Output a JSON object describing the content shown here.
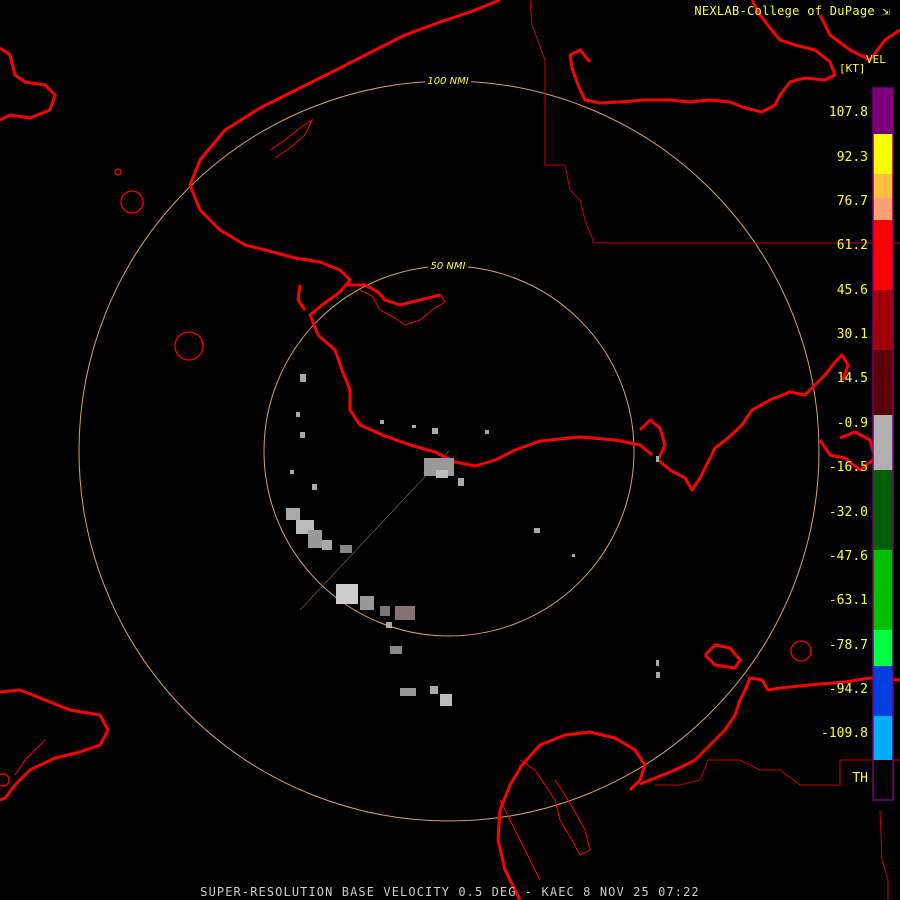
{
  "header": {
    "credit": "NEXLAB-College of DuPage",
    "credit_icon": "external-link-icon"
  },
  "colorbar": {
    "title": "VEL",
    "unit": "[KT]",
    "labels": [
      "107.8",
      "92.3",
      "76.7",
      "61.2",
      "45.6",
      "30.1",
      "14.5",
      "-0.9",
      "-16.5",
      "-32.0",
      "-47.6",
      "-63.1",
      "-78.7",
      "-94.2",
      "-109.8",
      "TH"
    ],
    "colors": {
      "purple": "#7a007a",
      "yellow": "#ffff00",
      "orange": "#ffa050",
      "red": "#ff0000",
      "darkred": "#5a0000",
      "gray": "#b0b0b0",
      "green": "#00c000",
      "lightgreen": "#00ff40",
      "blue": "#0060ff",
      "cyan": "#00b0ff"
    }
  },
  "map": {
    "range_rings": [
      "50 NMI",
      "100 NMI"
    ],
    "ring_color": "#d8a070",
    "coast_color": "#ff0000",
    "border_color": "#c80000",
    "echo_color": "#aaaaaa"
  },
  "footer": {
    "title": "SUPER-RESOLUTION BASE VELOCITY 0.5 DEG - KAEC 8 NOV 25 07:22"
  }
}
